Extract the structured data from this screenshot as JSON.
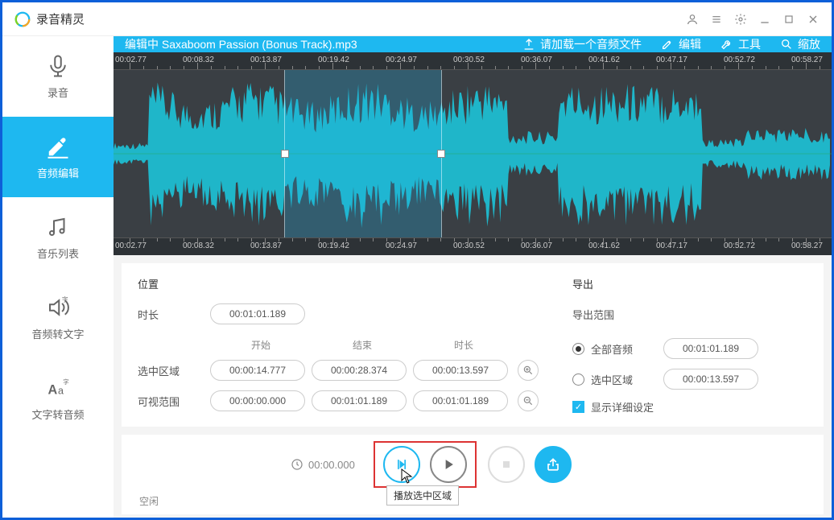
{
  "app": {
    "title": "录音精灵"
  },
  "sidebar": {
    "items": [
      {
        "label": "录音"
      },
      {
        "label": "音频编辑"
      },
      {
        "label": "音乐列表"
      },
      {
        "label": "音频转文字"
      },
      {
        "label": "文字转音频"
      }
    ]
  },
  "toolbar": {
    "editing_prefix": "编辑中",
    "filename": "Saxaboom Passion (Bonus Track).mp3",
    "load": "请加载一个音频文件",
    "edit": "编辑",
    "tools": "工具",
    "zoom": "缩放"
  },
  "ruler": {
    "ticks": [
      "00:02.77",
      "00:08.32",
      "00:13.87",
      "00:19.42",
      "00:24.97",
      "00:30.52",
      "00:36.07",
      "00:41.62",
      "00:47.17",
      "00:52.72",
      "00:58.27"
    ]
  },
  "panel": {
    "position": "位置",
    "duration_label": "时长",
    "duration": "00:01:01.189",
    "col_start": "开始",
    "col_end": "结束",
    "col_dur": "时长",
    "selected_label": "选中区域",
    "selected_start": "00:00:14.777",
    "selected_end": "00:00:28.374",
    "selected_dur": "00:00:13.597",
    "visible_label": "可视范围",
    "visible_start": "00:00:00.000",
    "visible_end": "00:01:01.189",
    "visible_dur": "00:01:01.189",
    "export": "导出",
    "export_range": "导出范围",
    "opt_all": "全部音频",
    "opt_all_time": "00:01:01.189",
    "opt_sel": "选中区域",
    "opt_sel_time": "00:00:13.597",
    "show_advanced": "显示详细设定"
  },
  "playback": {
    "time": "00:00.000",
    "tooltip": "播放选中区域"
  },
  "status": "空闲"
}
